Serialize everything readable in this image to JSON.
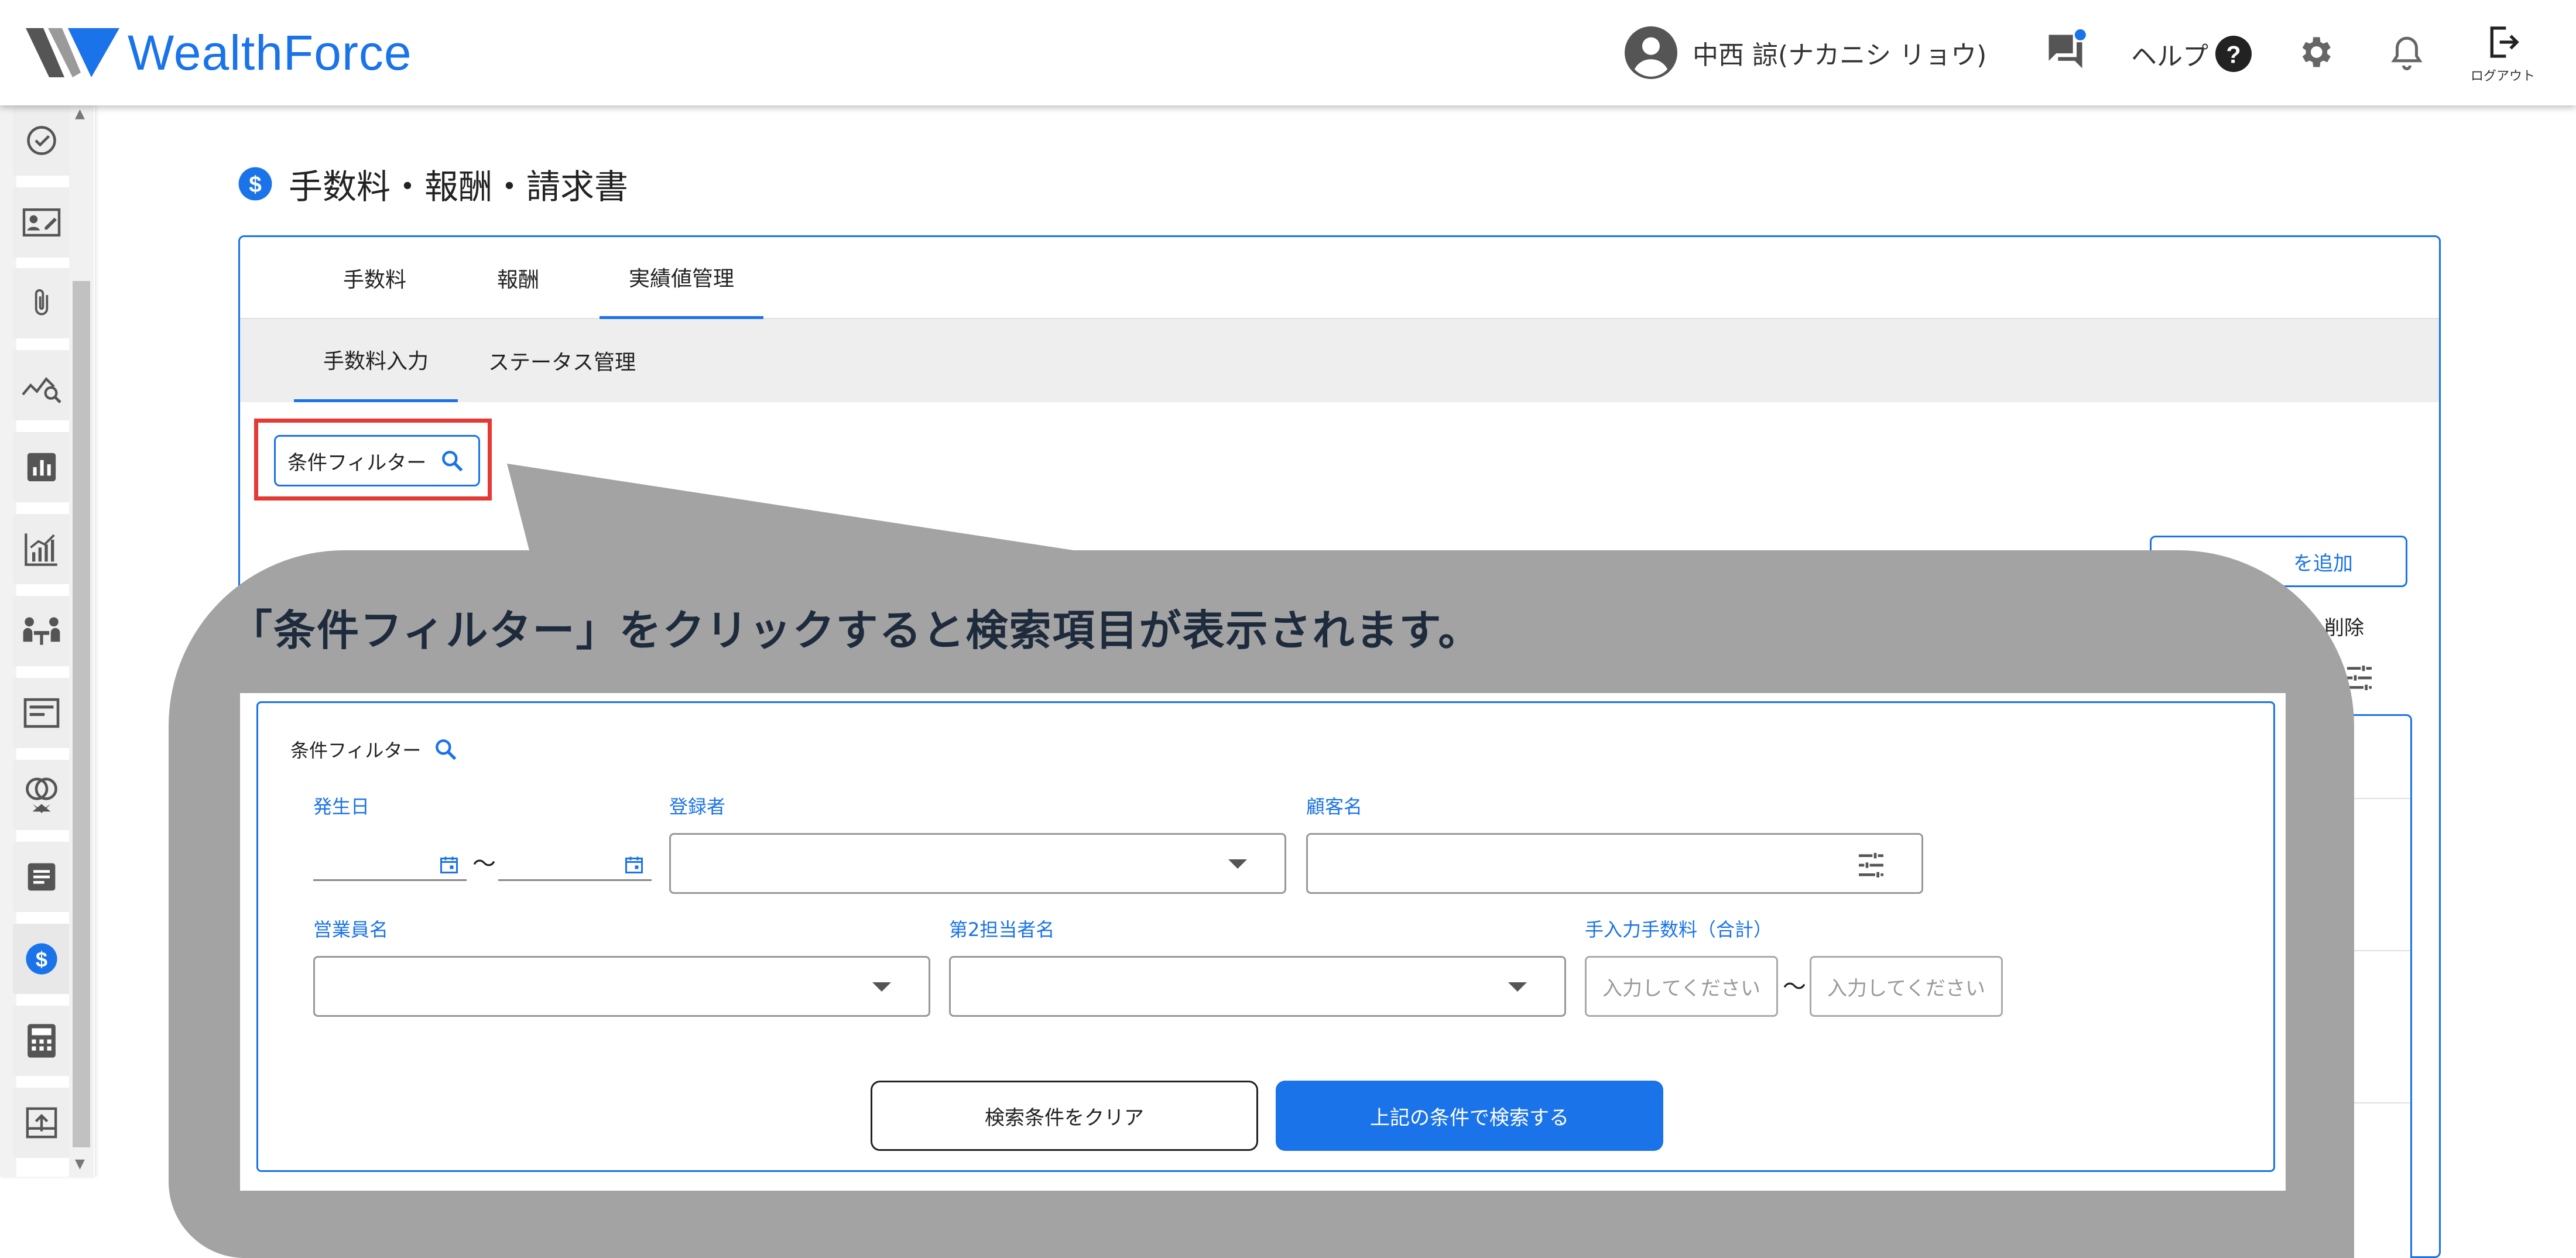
{
  "header": {
    "logo_text": "WealthForce",
    "user_name": "中西 諒(ナカニシ リョウ)",
    "help_label": "ヘルプ",
    "logout_label": "ログアウト",
    "brand_color": "#1a73e8",
    "notification_dot_color": "#1a73e8"
  },
  "sidebar": {
    "items": [
      {
        "icon": "check-circle-icon"
      },
      {
        "icon": "id-card-edit-icon"
      },
      {
        "icon": "paperclip-icon"
      },
      {
        "icon": "chart-search-icon"
      },
      {
        "icon": "bar-chart-icon"
      },
      {
        "icon": "growth-chart-icon"
      },
      {
        "icon": "meeting-icon"
      },
      {
        "icon": "document-card-icon"
      },
      {
        "icon": "rings-icon"
      },
      {
        "icon": "note-icon"
      },
      {
        "icon": "dollar-icon",
        "active": true
      },
      {
        "icon": "calculator-icon"
      },
      {
        "icon": "upload-icon"
      }
    ]
  },
  "page": {
    "title": "手数料・報酬・請求書",
    "tabs": [
      "手数料",
      "報酬",
      "実績値管理"
    ],
    "active_tab": "実績値管理",
    "subtabs": [
      "手数料入力",
      "ステータス管理"
    ],
    "active_subtab": "手数料入力",
    "filter_label": "条件フィルター",
    "add_button_label": "を追加",
    "delete_label": "削除"
  },
  "callout": {
    "text": "「条件フィルター」をクリックすると検索項目が表示されます。",
    "filter_panel": {
      "title": "条件フィルター",
      "fields": {
        "occurrence_date": "発生日",
        "registrant": "登録者",
        "customer_name": "顧客名",
        "sales_rep": "営業員名",
        "second_rep": "第2担当者名",
        "manual_fee": "手入力手数料（合計）"
      },
      "tilde": "〜",
      "fee_min_placeholder": "入力してください",
      "fee_max_placeholder": "入力してください",
      "clear_button": "検索条件をクリア",
      "search_button": "上記の条件で検索する"
    }
  }
}
